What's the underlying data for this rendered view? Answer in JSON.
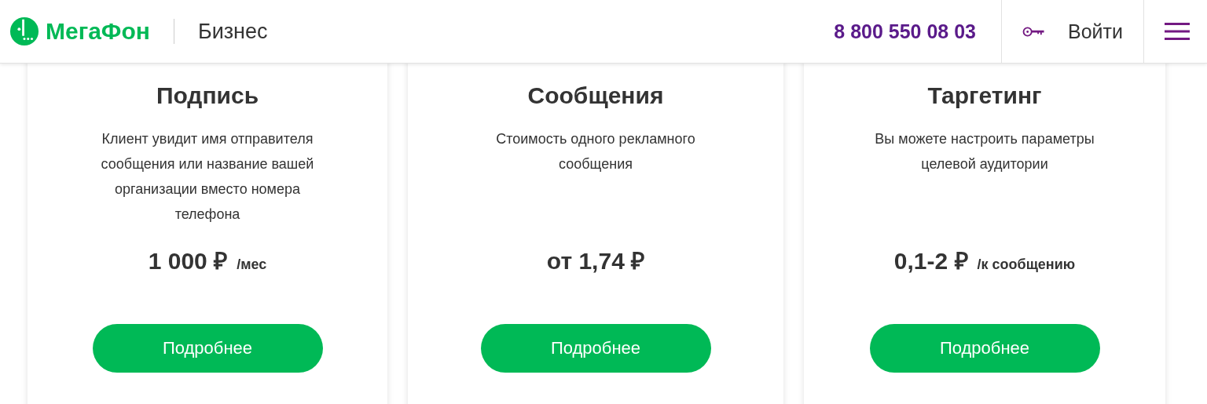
{
  "header": {
    "logo": "МегаФон",
    "section": "Бизнес",
    "phone": "8 800 550 08 03",
    "login": "Войти"
  },
  "cards": [
    {
      "title": "Подпись",
      "description": "Клиент увидит имя отправителя сообщения или название вашей организации вместо номера телефона",
      "price": "1 000 ₽",
      "unit": "/мес",
      "button": "Подробнее"
    },
    {
      "title": "Сообщения",
      "description": "Стоимость одного рекламного сообщения",
      "price": "от 1,74 ₽",
      "button": "Подробнее"
    },
    {
      "title": "Таргетинг",
      "description": "Вы можете настроить параметры целевой аудитории",
      "price": "0,1-2 ₽",
      "unit": "/к сообщению",
      "button": "Подробнее"
    }
  ]
}
